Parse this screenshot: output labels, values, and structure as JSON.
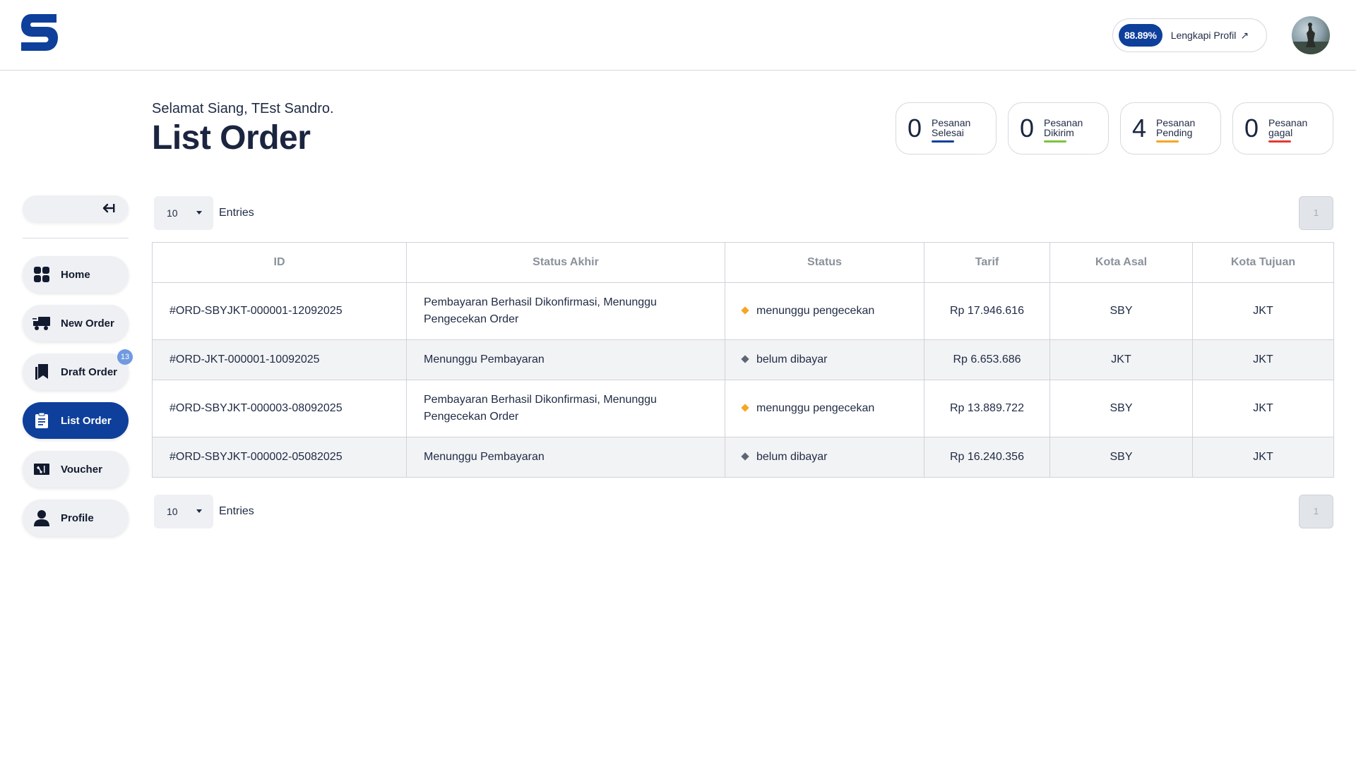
{
  "header": {
    "profile_completion": "88.89%",
    "profile_link_label": "Lengkapi Profil",
    "profile_link_arrow": "↗"
  },
  "greeting": "Selamat Siang, TEst Sandro.",
  "page_title": "List Order",
  "stats": [
    {
      "count": "0",
      "label_line1": "Pesanan",
      "label_line2": "Selesai",
      "color": "#0e3f9b"
    },
    {
      "count": "0",
      "label_line1": "Pesanan",
      "label_line2": "Dikirim",
      "color": "#7cc242"
    },
    {
      "count": "4",
      "label_line1": "Pesanan",
      "label_line2": "Pending",
      "color": "#f5a623"
    },
    {
      "count": "0",
      "label_line1": "Pesanan",
      "label_line2": "gagal",
      "color": "#e53935"
    }
  ],
  "sidebar": {
    "items": [
      {
        "label": "Home",
        "icon": "grid-icon"
      },
      {
        "label": "New Order",
        "icon": "truck-icon"
      },
      {
        "label": "Draft Order",
        "icon": "draft-icon",
        "badge": "13"
      },
      {
        "label": "List Order",
        "icon": "clipboard-icon",
        "active": true
      },
      {
        "label": "Voucher",
        "icon": "ticket-icon"
      },
      {
        "label": "Profile",
        "icon": "user-icon"
      }
    ]
  },
  "entries": {
    "value": "10",
    "label": "Entries"
  },
  "pagination": {
    "current_page": "1"
  },
  "table": {
    "columns": [
      "ID",
      "Status Akhir",
      "Status",
      "Tarif",
      "Kota Asal",
      "Kota Tujuan"
    ],
    "rows": [
      {
        "id": "#ORD-SBYJKT-000001-12092025",
        "status_akhir": "Pembayaran Berhasil Dikonfirmasi, Menunggu Pengecekan Order",
        "status": "menunggu pengecekan",
        "status_color": "#f5a623",
        "tarif": "Rp 17.946.616",
        "kota_asal": "SBY",
        "kota_tujuan": "JKT"
      },
      {
        "id": "#ORD-JKT-000001-10092025",
        "status_akhir": "Menunggu Pembayaran",
        "status": "belum dibayar",
        "status_color": "#5f6673",
        "tarif": "Rp 6.653.686",
        "kota_asal": "JKT",
        "kota_tujuan": "JKT"
      },
      {
        "id": "#ORD-SBYJKT-000003-08092025",
        "status_akhir": "Pembayaran Berhasil Dikonfirmasi, Menunggu Pengecekan Order",
        "status": "menunggu pengecekan",
        "status_color": "#f5a623",
        "tarif": "Rp 13.889.722",
        "kota_asal": "SBY",
        "kota_tujuan": "JKT"
      },
      {
        "id": "#ORD-SBYJKT-000002-05082025",
        "status_akhir": "Menunggu Pembayaran",
        "status": "belum dibayar",
        "status_color": "#5f6673",
        "tarif": "Rp 16.240.356",
        "kota_asal": "SBY",
        "kota_tujuan": "JKT"
      }
    ]
  },
  "colors": {
    "brand": "#0e3f9b",
    "nav_bg": "#eef0f3"
  }
}
